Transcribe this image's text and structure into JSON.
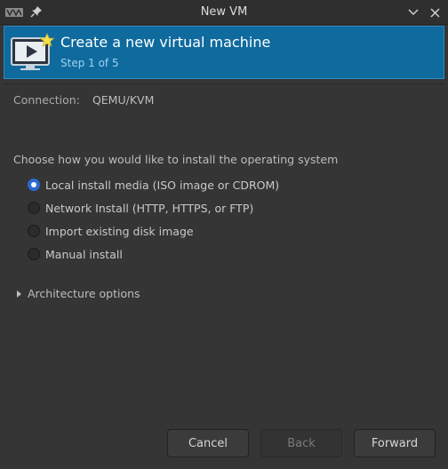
{
  "window": {
    "title": "New VM",
    "app_icon": "virt-manager-icon",
    "pin_icon": "pin-icon",
    "minimize_icon": "chevron-down-icon",
    "close_icon": "close-icon"
  },
  "banner": {
    "title": "Create a new virtual machine",
    "step": "Step 1 of 5",
    "icon": "new-vm-monitor-icon",
    "bg_color": "#0f6a9e"
  },
  "connection": {
    "label": "Connection:",
    "value": "QEMU/KVM"
  },
  "install": {
    "prompt": "Choose how you would like to install the operating system",
    "options": [
      {
        "label": "Local install media (ISO image or CDROM)",
        "checked": true
      },
      {
        "label": "Network Install (HTTP, HTTPS, or FTP)",
        "checked": false
      },
      {
        "label": "Import existing disk image",
        "checked": false
      },
      {
        "label": "Manual install",
        "checked": false
      }
    ]
  },
  "architecture": {
    "label": "Architecture options",
    "expanded": false
  },
  "buttons": {
    "cancel": "Cancel",
    "back": "Back",
    "forward": "Forward"
  }
}
